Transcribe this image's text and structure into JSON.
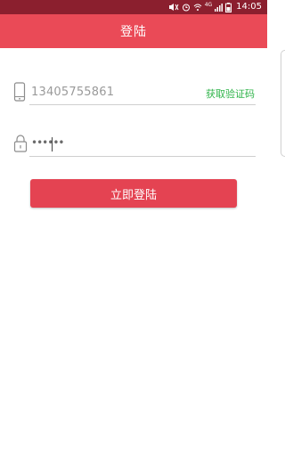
{
  "status_bar": {
    "network_label": "4G",
    "time": "14:05"
  },
  "app_bar": {
    "title": "登陆"
  },
  "phone_field": {
    "value": "13405755861",
    "get_code_label": "获取验证码"
  },
  "password_field": {
    "masked_value": "••••••"
  },
  "login_button": {
    "label": "立即登陆"
  },
  "colors": {
    "status_bar": "#8b1f2e",
    "app_bar": "#ea4a57",
    "button": "#e44352",
    "link": "#2fb44a"
  },
  "icons": {
    "phone": "phone-icon",
    "lock": "lock-icon"
  }
}
